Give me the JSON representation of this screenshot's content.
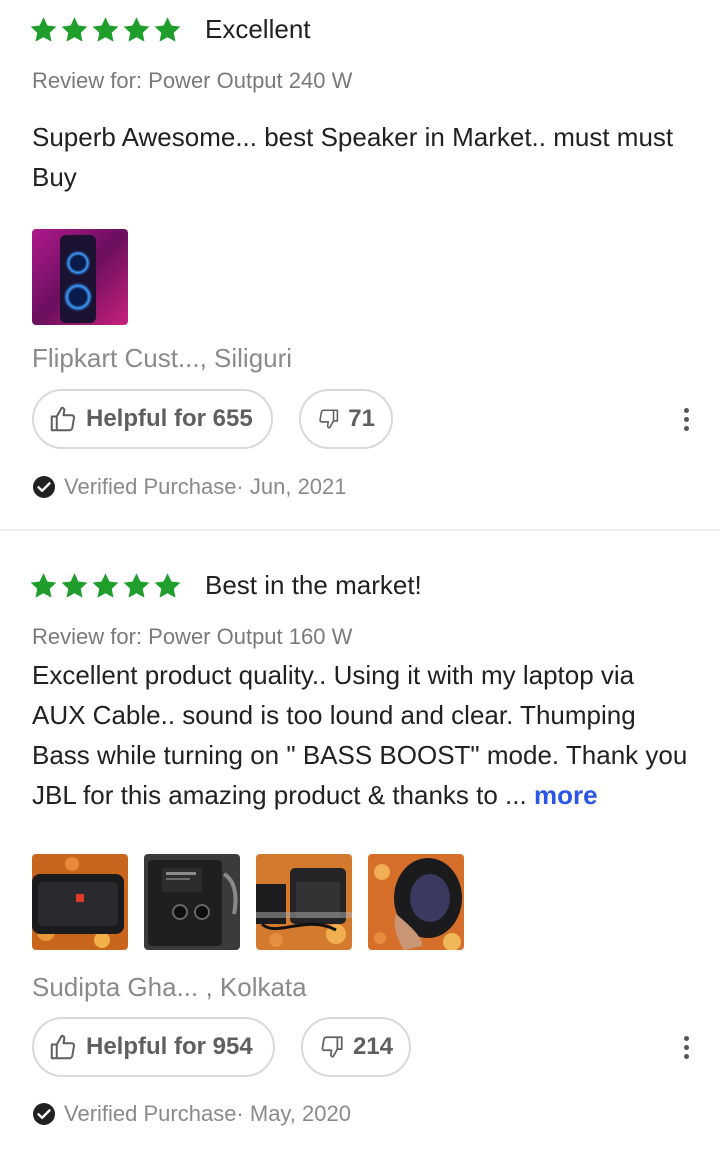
{
  "reviews": [
    {
      "rating": 5,
      "title": "Excellent",
      "variant": "Review for: Power Output 240 W",
      "text": "Superb Awesome... best Speaker in Market.. must must Buy",
      "more": "",
      "photos": [
        "speaker-blue-lights"
      ],
      "author": "Flipkart Cust..., Siliguri",
      "helpful_label": "Helpful for 655",
      "unhelpful_count": "71",
      "verified": "Verified Purchase· Jun, 2021"
    },
    {
      "rating": 5,
      "title": "Best in the market!",
      "variant": "Review for: Power Output 160 W",
      "text": "Excellent product quality.. Using it with my laptop via AUX Cable.. sound is too lound and clear. Thumping Bass while turning on \" BASS BOOST\" mode. Thank you JBL for this amazing product & thanks to ...",
      "more": "more",
      "photos": [
        "speaker-front",
        "speaker-back-panel",
        "speaker-side",
        "speaker-handheld"
      ],
      "author": "Sudipta Gha... , Kolkata",
      "helpful_label": "Helpful for 954",
      "unhelpful_count": "214",
      "verified": "Verified Purchase· May, 2020"
    }
  ],
  "colors": {
    "star": "#1f9e2c",
    "link": "#2a55e5",
    "muted": "#8a8a8a",
    "border": "#d9d9d9"
  },
  "icons": [
    "star-icon",
    "thumbs-up-icon",
    "thumbs-down-icon",
    "more-vertical-icon",
    "verified-check-icon"
  ]
}
